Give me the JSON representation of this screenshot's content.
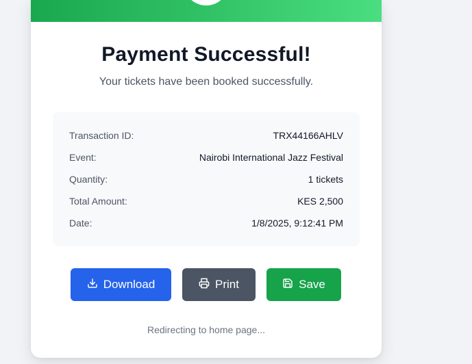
{
  "header": {
    "title": "Payment Successful!",
    "subtitle": "Your tickets have been booked successfully."
  },
  "details": {
    "rows": [
      {
        "label": "Transaction ID:",
        "value": "TRX44166AHLV"
      },
      {
        "label": "Event:",
        "value": "Nairobi International Jazz Festival"
      },
      {
        "label": "Quantity:",
        "value": "1 tickets"
      },
      {
        "label": "Total Amount:",
        "value": "KES 2,500"
      },
      {
        "label": "Date:",
        "value": "1/8/2025, 9:12:41 PM"
      }
    ]
  },
  "actions": {
    "download_label": "Download",
    "download_icon": "download-icon",
    "print_label": "Print",
    "print_icon": "printer-icon",
    "save_label": "Save",
    "save_icon": "save-icon"
  },
  "footer": {
    "redirect_text": "Redirecting to home page..."
  },
  "colors": {
    "success_green_start": "#1aa84f",
    "success_green_end": "#4ade80",
    "download_blue": "#2563eb",
    "print_gray": "#4b5563",
    "save_green": "#16a34a"
  }
}
